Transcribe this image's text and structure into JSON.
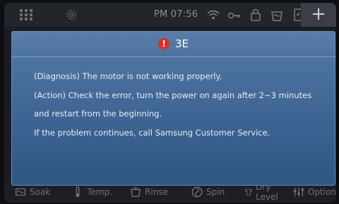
{
  "status_bar": {
    "time": "PM 07:56",
    "plus_label": "+"
  },
  "dialog": {
    "error_code": "3E",
    "lines": [
      "(Diagnosis) The motor is not working properly.",
      "(Action) Check the error, turn the power on again after 2~3 minutes",
      "and restart from the beginning.",
      "If the problem continues, call Samsung Customer Service."
    ]
  },
  "menu": {
    "items": [
      {
        "label": "Soak",
        "icon": "soak-icon"
      },
      {
        "label": "Temp.",
        "icon": "thermometer-icon"
      },
      {
        "label": "Rinse",
        "icon": "rinse-icon"
      },
      {
        "label": "Spin",
        "icon": "spin-icon"
      },
      {
        "label": "Dry Level",
        "icon": "shirt-icon"
      },
      {
        "label": "Options",
        "icon": "options-icon"
      }
    ]
  },
  "colors": {
    "dialog_bg": "#3e6593",
    "error_red": "#d9302c"
  }
}
